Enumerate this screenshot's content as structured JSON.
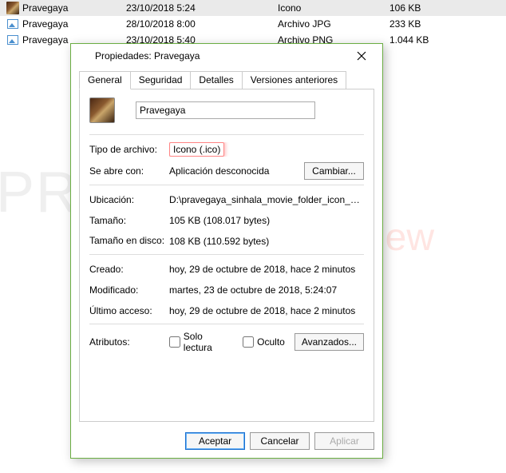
{
  "filelist": {
    "rows": [
      {
        "name": "Pravegaya",
        "date": "23/10/2018 5:24",
        "type": "Icono",
        "size": "106 KB",
        "icon": "ico",
        "selected": true
      },
      {
        "name": "Pravegaya",
        "date": "28/10/2018 8:00",
        "type": "Archivo JPG",
        "size": "233 KB",
        "icon": "pic",
        "selected": false
      },
      {
        "name": "Pravegaya",
        "date": "23/10/2018 5:40",
        "type": "Archivo PNG",
        "size": "1.044 KB",
        "icon": "pic",
        "selected": false
      }
    ]
  },
  "dialog": {
    "title": "Propiedades: Pravegaya",
    "tabs": {
      "general": "General",
      "security": "Seguridad",
      "details": "Detalles",
      "prev": "Versiones anteriores"
    },
    "name_value": "Pravegaya",
    "labels": {
      "filetype": "Tipo de archivo:",
      "opens_with": "Se abre con:",
      "change": "Cambiar...",
      "location": "Ubicación:",
      "size": "Tamaño:",
      "size_on_disk": "Tamaño en disco:",
      "created": "Creado:",
      "modified": "Modificado:",
      "accessed": "Último acceso:",
      "attributes": "Atributos:",
      "readonly": "Solo lectura",
      "hidden": "Oculto",
      "advanced": "Avanzados..."
    },
    "values": {
      "filetype": "Icono (.ico)",
      "opens_with": "Aplicación desconocida",
      "location": "D:\\pravegaya_sinhala_movie_folder_icon_by_p",
      "size": "105 KB (108.017 bytes)",
      "size_on_disk": "108 KB (110.592 bytes)",
      "created": "hoy, 29 de octubre de 2018, hace 2 minutos",
      "modified": "martes, 23 de octubre de 2018, 5:24:07",
      "accessed": "hoy, 29 de octubre de 2018, hace 2 minutos"
    },
    "buttons": {
      "ok": "Aceptar",
      "cancel": "Cancelar",
      "apply": "Aplicar"
    }
  }
}
